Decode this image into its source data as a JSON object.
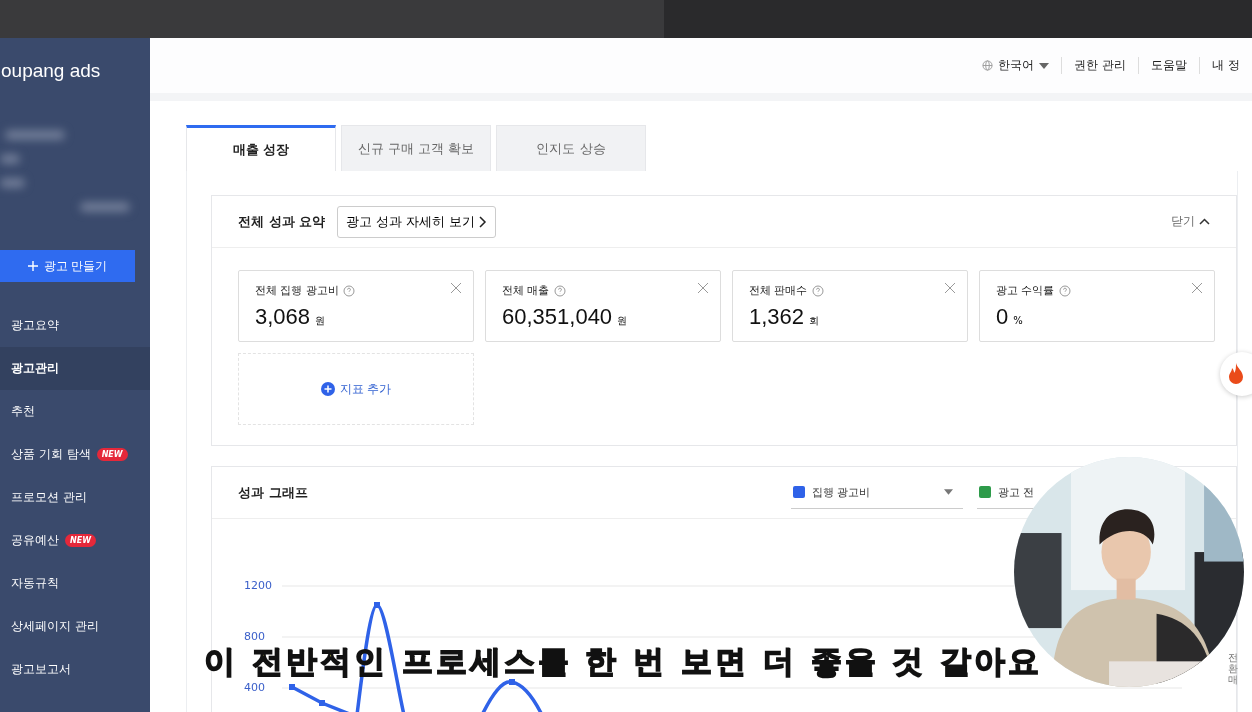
{
  "sidebar": {
    "logo": "oupang ads",
    "create_button": "광고 만들기",
    "items": [
      {
        "label": "광고요약",
        "selected": false
      },
      {
        "label": "광고관리",
        "selected": true
      },
      {
        "label": "추천",
        "selected": false
      },
      {
        "label": "상품 기회 탐색",
        "selected": false,
        "badge": "NEW"
      },
      {
        "label": "프로모션 관리",
        "selected": false
      },
      {
        "label": "공유예산",
        "selected": false,
        "badge": "NEW"
      },
      {
        "label": "자동규칙",
        "selected": false
      },
      {
        "label": "상세페이지 관리",
        "selected": false
      },
      {
        "label": "광고보고서",
        "selected": false
      }
    ]
  },
  "header": {
    "language": "한국어",
    "links": [
      "권한 관리",
      "도움말",
      "내 정"
    ]
  },
  "tabs": [
    {
      "label": "매출 성장",
      "selected": true
    },
    {
      "label": "신규 구매 고객 확보",
      "selected": false
    },
    {
      "label": "인지도 상승",
      "selected": false
    }
  ],
  "summary": {
    "title": "전체 성과 요약",
    "detail_button": "광고 성과 자세히 보기",
    "collapse": "닫기",
    "metrics": [
      {
        "label": "전체 집행 광고비",
        "value": "3,068",
        "unit": "원"
      },
      {
        "label": "전체 매출",
        "value": "60,351,040",
        "unit": "원"
      },
      {
        "label": "전체 판매수",
        "value": "1,362",
        "unit": "회"
      },
      {
        "label": "광고 수익률",
        "value": "0",
        "unit": "%"
      }
    ],
    "add_metric": "지표 추가"
  },
  "graph": {
    "title": "성과 그래프",
    "legend": [
      {
        "label": "집행 광고비",
        "color": "#2f62e8"
      },
      {
        "label": "광고 전",
        "color": "#2e9b4a"
      }
    ],
    "y_ticks": [
      "1200",
      "800",
      "400"
    ],
    "right_label": "전환 매"
  },
  "video_overlay": {
    "subtitle": "이 전반적인 프로세스를 한 번 보면 더 좋을 것 같아요"
  }
}
